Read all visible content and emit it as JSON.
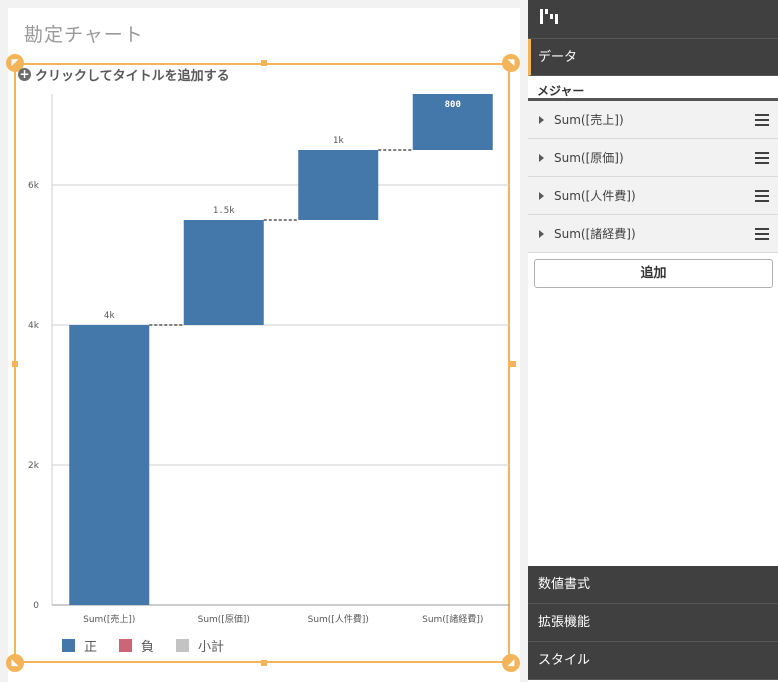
{
  "sheet": {
    "title": "勘定チャート"
  },
  "chart_header": {
    "add_title_text": "クリックしてタイトルを追加する"
  },
  "chart_data": {
    "type": "bar",
    "subtype": "waterfall",
    "categories": [
      "Sum([売上])",
      "Sum([原価])",
      "Sum([人件費])",
      "Sum([諸経費])"
    ],
    "values": [
      4000,
      1500,
      1000,
      800
    ],
    "starts": [
      0,
      4000,
      5500,
      6500
    ],
    "data_labels": [
      "4k",
      "1.5k",
      "1k",
      "800"
    ],
    "ylim": [
      0,
      7300
    ],
    "yticks": [
      0,
      2000,
      4000,
      6000
    ],
    "ytick_labels": [
      "0",
      "2k",
      "4k",
      "6k"
    ],
    "grid": true,
    "legend_position": "bottom-left",
    "legend": [
      {
        "name": "正",
        "color": "#4477aa"
      },
      {
        "name": "負",
        "color": "#cc6677"
      },
      {
        "name": "小計",
        "color": "#c3c3c3"
      }
    ],
    "bar_color": "#4477aa",
    "connector_color": "#555555"
  },
  "panel": {
    "data_section": "データ",
    "measures_label": "メジャー",
    "measures": [
      "Sum([売上])",
      "Sum([原価])",
      "Sum([人件費])",
      "Sum([諸経費])"
    ],
    "add_button": "追加",
    "sections": [
      "数値書式",
      "拡張機能",
      "スタイル"
    ]
  },
  "colors": {
    "accent": "#f4b55a",
    "panel_dark": "#404040"
  }
}
